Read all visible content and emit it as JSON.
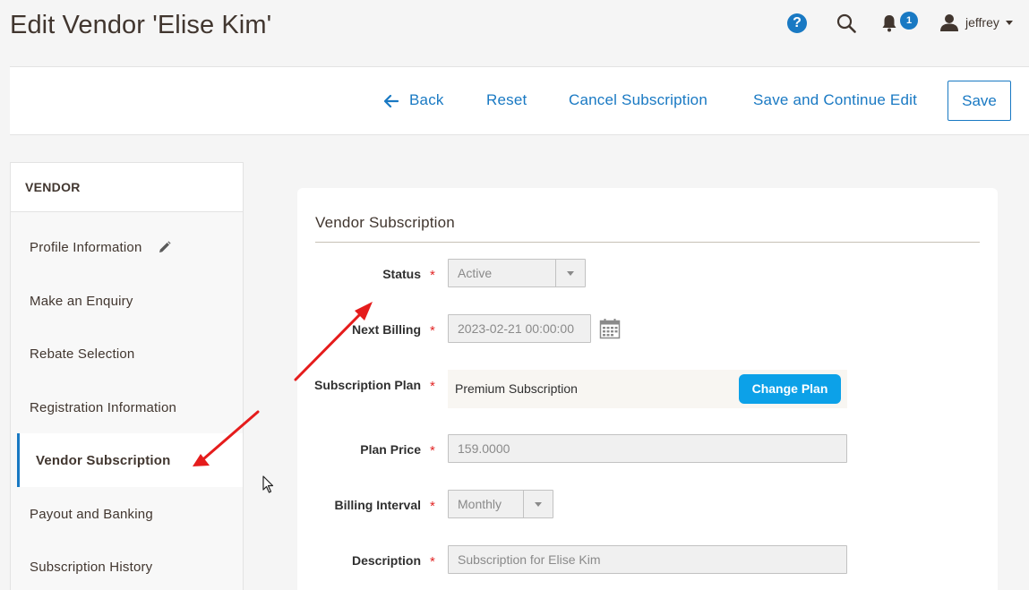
{
  "page": {
    "title": "Edit Vendor 'Elise Kim'"
  },
  "header": {
    "help_glyph": "?",
    "notification_count": "1",
    "user_name": "jeffrey",
    "icons": [
      "help-icon",
      "search-icon",
      "bell-icon",
      "user-icon",
      "caret-down-icon"
    ]
  },
  "actions": {
    "back": "Back",
    "reset": "Reset",
    "cancel_subscription": "Cancel Subscription",
    "save_continue": "Save and Continue Edit",
    "save": "Save"
  },
  "sidebar": {
    "header": "VENDOR",
    "items": [
      {
        "label": "Profile Information",
        "icon": "pencil-icon"
      },
      {
        "label": "Make an Enquiry"
      },
      {
        "label": "Rebate Selection"
      },
      {
        "label": "Registration Information"
      },
      {
        "label": "Vendor Subscription",
        "active": true
      },
      {
        "label": "Payout and Banking"
      },
      {
        "label": "Subscription History"
      }
    ]
  },
  "form": {
    "title": "Vendor Subscription",
    "required_marker": "*",
    "status": {
      "label": "Status",
      "value": "Active"
    },
    "next_billing": {
      "label": "Next Billing",
      "value": "2023-02-21 00:00:00"
    },
    "subscription_plan": {
      "label": "Subscription Plan",
      "value": "Premium Subscription",
      "button": "Change Plan"
    },
    "plan_price": {
      "label": "Plan Price",
      "value": "159.0000"
    },
    "billing_interval": {
      "label": "Billing Interval",
      "value": "Monthly"
    },
    "description": {
      "label": "Description",
      "value": "Subscription for Elise Kim"
    }
  },
  "colors": {
    "accent": "#1979c3",
    "change_plan": "#0ca1e8",
    "required": "#e22626",
    "annotation_arrow": "#e51c1c"
  }
}
